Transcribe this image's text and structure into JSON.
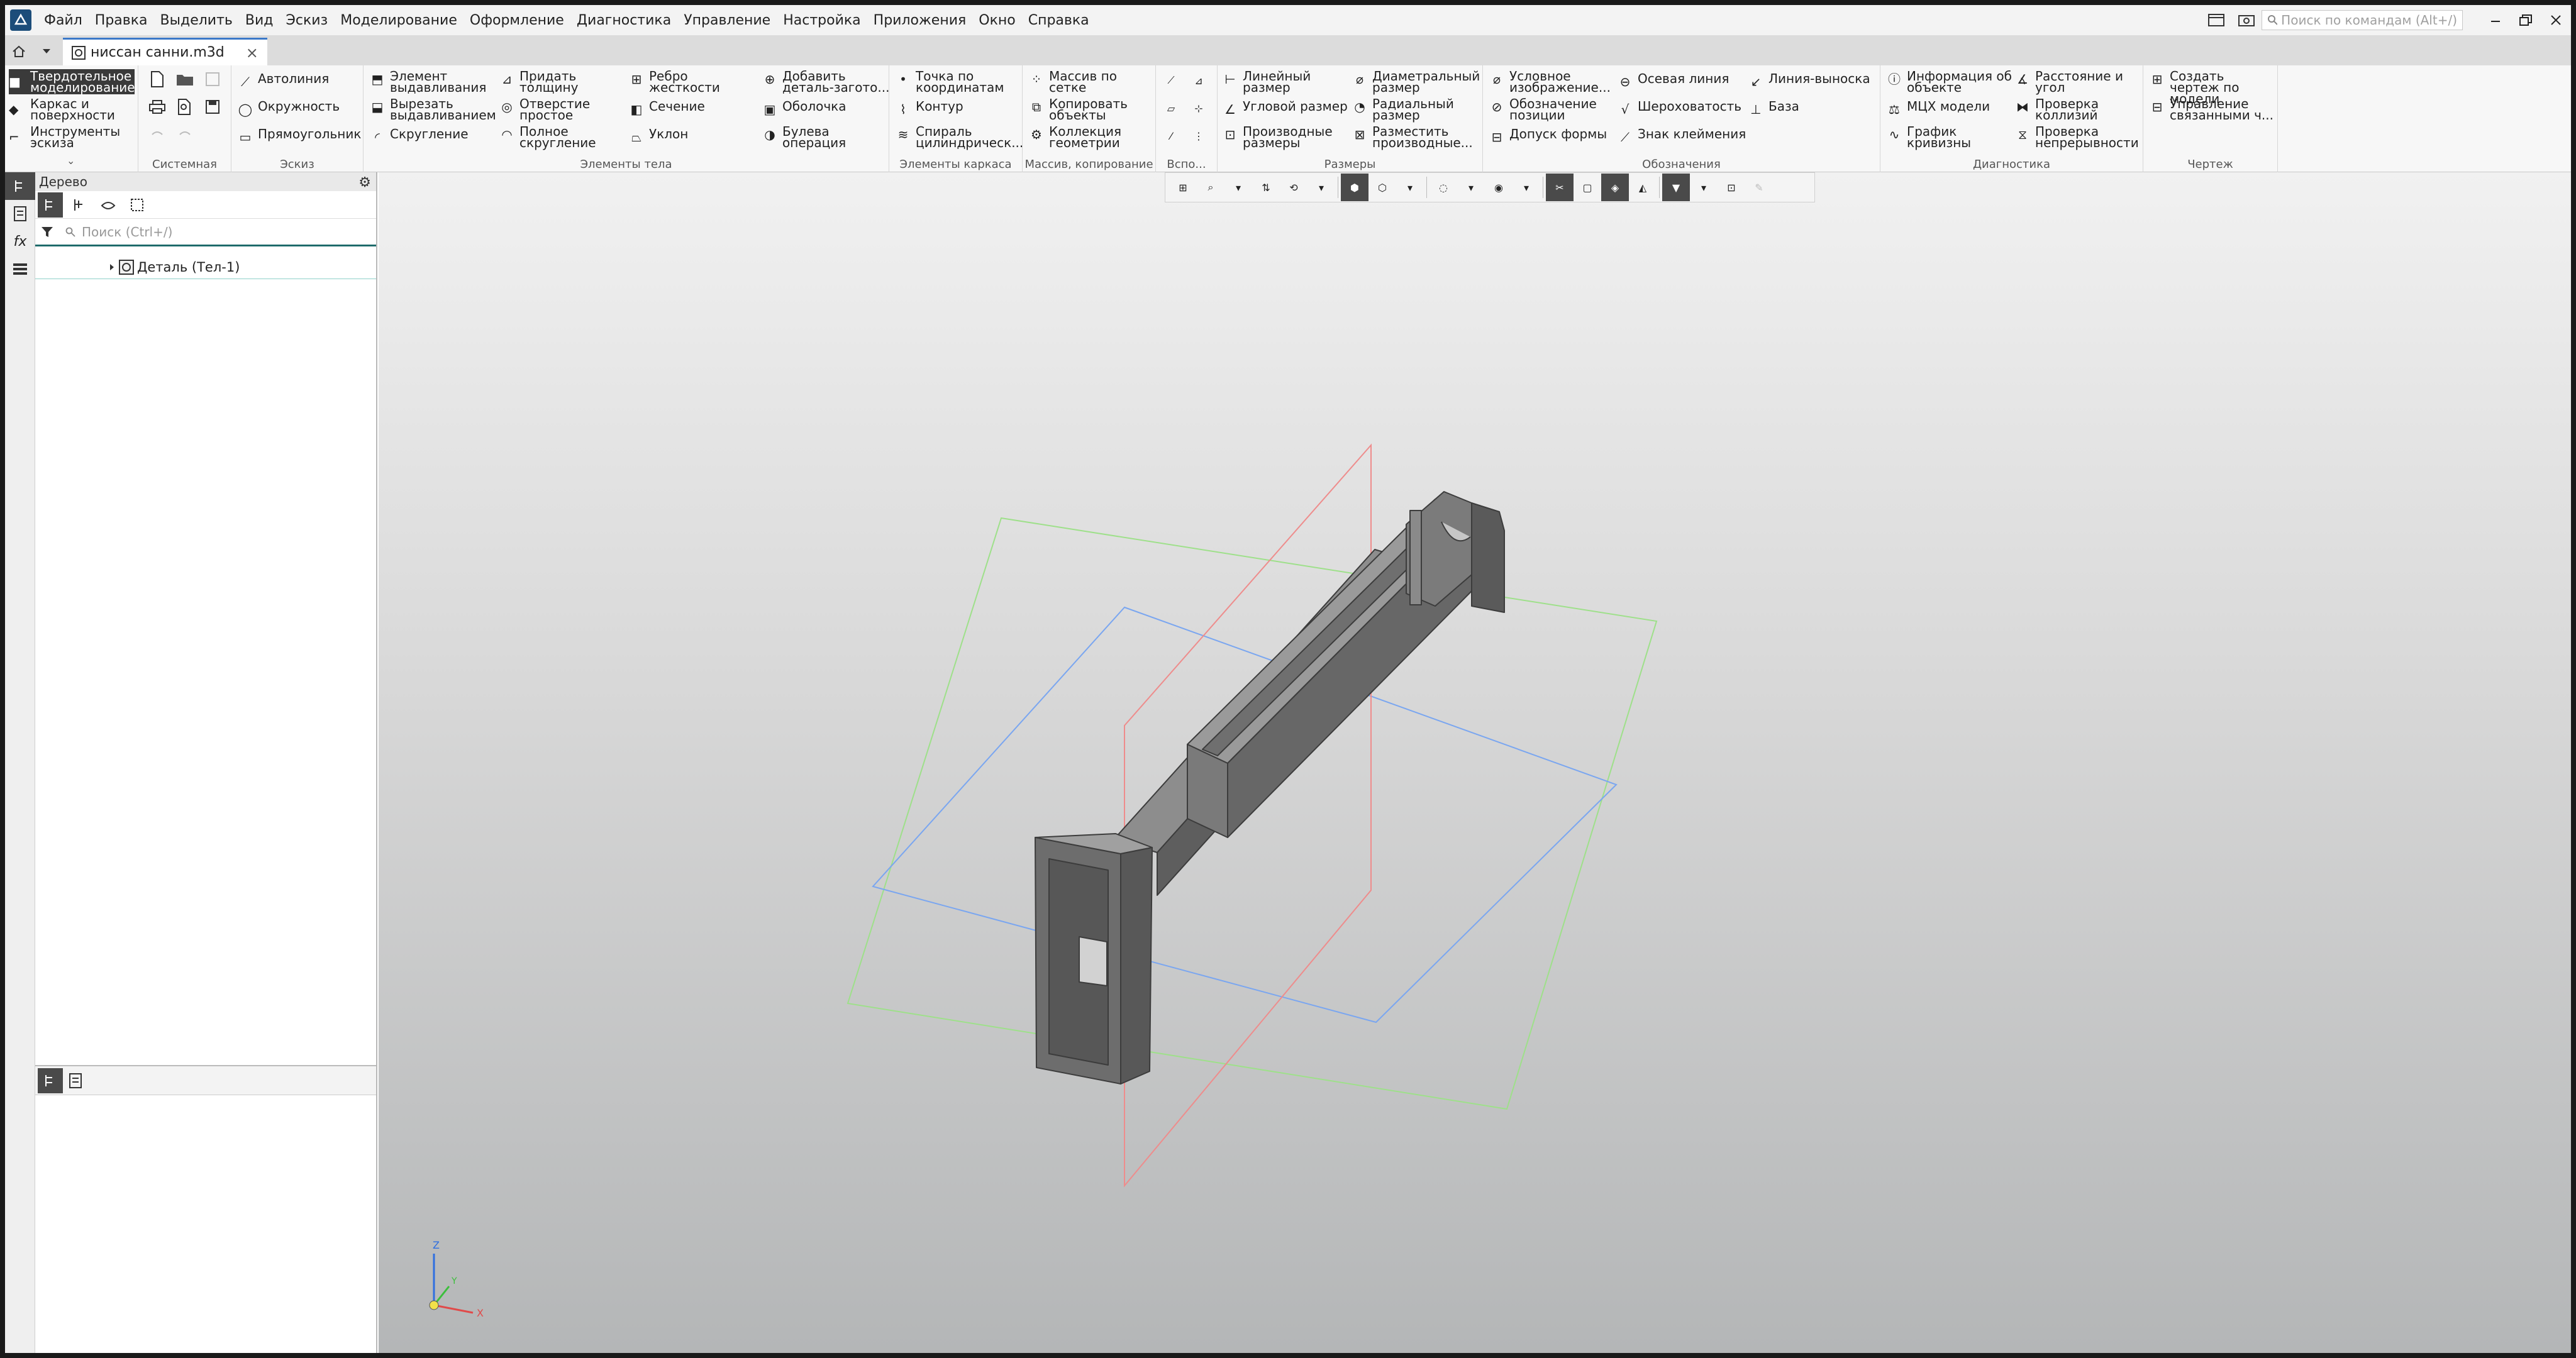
{
  "menu": [
    "Файл",
    "Правка",
    "Выделить",
    "Вид",
    "Эскиз",
    "Моделирование",
    "Оформление",
    "Диагностика",
    "Управление",
    "Настройка",
    "Приложения",
    "Окно",
    "Справка"
  ],
  "command_search": {
    "placeholder": "Поиск по командам (Alt+/)"
  },
  "tab": {
    "title": "ниссан санни.m3d",
    "close": "×"
  },
  "modes": [
    "Твердотельное моделирование",
    "Каркас и поверхности",
    "Инструменты эскиза"
  ],
  "groups": {
    "system": "Системная",
    "sketch": "Эскиз",
    "body": "Элементы тела",
    "frame": "Элементы каркаса",
    "array": "Массив, копирование",
    "aux": "Вспо...",
    "dims": "Размеры",
    "notes": "Обозначения",
    "diag": "Диагностика",
    "drawing": "Чертеж"
  },
  "sketch_tools": [
    "Автолиния",
    "Окружность",
    "Прямоугольник"
  ],
  "body_tools": [
    "Элемент выдавливания",
    "Вырезать выдавливанием",
    "Скругление",
    "Придать толщину",
    "Отверстие простое",
    "Полное скругление",
    "Ребро жесткости",
    "Сечение",
    "Уклон",
    "Добавить деталь-загото...",
    "Оболочка",
    "Булева операция"
  ],
  "frame_tools": [
    "Точка по координатам",
    "Контур",
    "Спираль цилиндрическ..."
  ],
  "array_tools": [
    "Массив по сетке",
    "Копировать объекты",
    "Коллекция геометрии"
  ],
  "dim_tools": [
    "Линейный размер",
    "Угловой размер",
    "Производные размеры",
    "Диаметральный размер",
    "Радиальный размер",
    "Разместить производные..."
  ],
  "note_tools": [
    "Условное изображение...",
    "Обозначение позиции",
    "Допуск формы",
    "Осевая линия",
    "Шероховатость",
    "Знак клеймения",
    "Линия-выноска",
    "База"
  ],
  "diag_tools": [
    "Информация об объекте",
    "МЦХ модели",
    "График кривизны",
    "Расстояние и угол",
    "Проверка коллизий",
    "Проверка непрерывности"
  ],
  "drawing_tools": [
    "Создать чертеж по модели",
    "Управление связанными ч..."
  ],
  "tree": {
    "title": "Дерево",
    "search_placeholder": "Поиск (Ctrl+/)",
    "node": "Деталь (Тел-1)"
  },
  "triad": {
    "x": "X",
    "y": "Y",
    "z": "Z"
  }
}
